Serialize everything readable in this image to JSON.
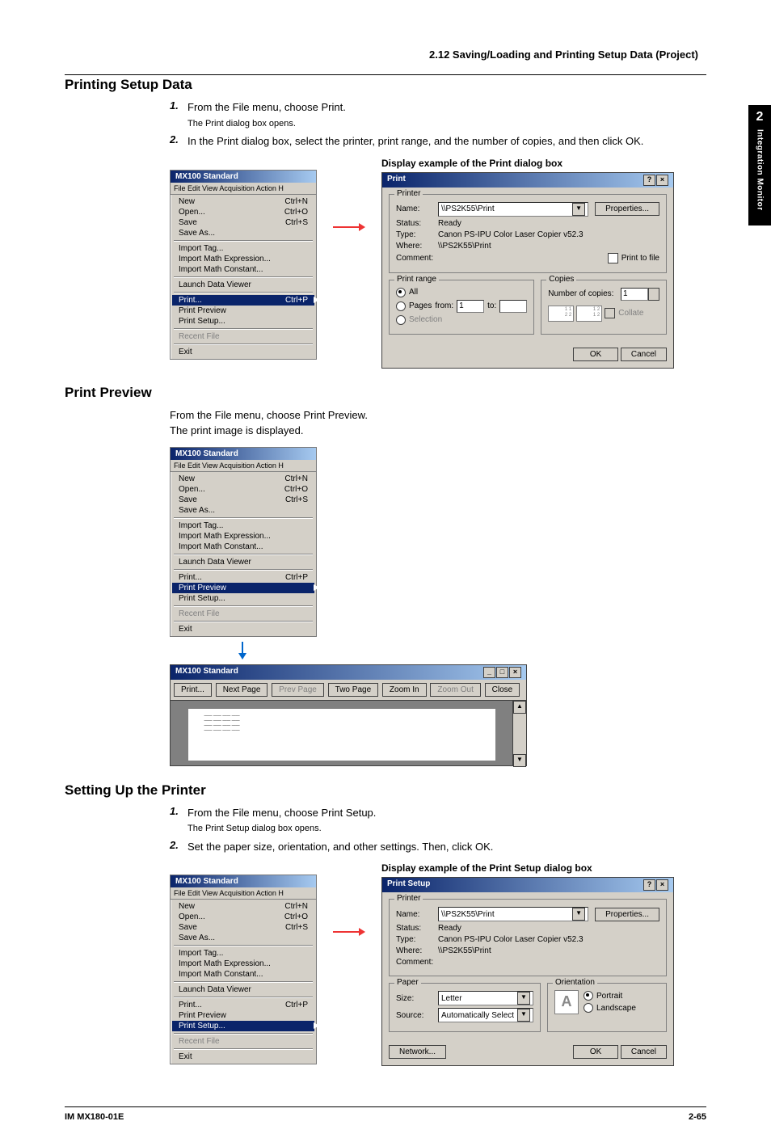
{
  "breadcrumb": "2.12  Saving/Loading and Printing Setup Data (Project)",
  "side_tab": {
    "num": "2",
    "label": "Integration Monitor"
  },
  "sec1": {
    "heading": "Printing Setup Data",
    "step1": {
      "num": "1.",
      "text": "From the File menu, choose Print.",
      "sub": "The Print dialog box opens."
    },
    "step2": {
      "num": "2.",
      "text": "In the Print dialog box, select the printer, print range, and the number of copies, and then click OK."
    },
    "caption": "Display example of the Print dialog box"
  },
  "sec2": {
    "heading": "Print Preview",
    "line1": "From the File menu, choose Print Preview.",
    "line2": "The print image is displayed."
  },
  "sec3": {
    "heading": "Setting Up the Printer",
    "step1": {
      "num": "1.",
      "text": "From the File menu, choose Print Setup.",
      "sub": "The Print Setup dialog box opens."
    },
    "step2": {
      "num": "2.",
      "text": "Set the paper size, orientation, and other settings. Then, click OK."
    },
    "caption": "Display example of the Print Setup dialog box"
  },
  "file_menu": {
    "title": "MX100 Standard",
    "menubar": "File   Edit   View   Acquisition   Action   H",
    "items": {
      "New": "New",
      "New_k": "Ctrl+N",
      "Open": "Open...",
      "Open_k": "Ctrl+O",
      "Save": "Save",
      "Save_k": "Ctrl+S",
      "SaveAs": "Save As...",
      "ImportTag": "Import Tag...",
      "ImportMathExpr": "Import Math Expression...",
      "ImportMathConst": "Import Math Constant...",
      "LaunchViewer": "Launch Data Viewer",
      "Print": "Print...",
      "Print_k": "Ctrl+P",
      "PrintPreview": "Print Preview",
      "PrintSetup": "Print Setup...",
      "RecentFile": "Recent File",
      "Exit": "Exit"
    }
  },
  "print_dialog": {
    "title": "Print",
    "printer_legend": "Printer",
    "name_lbl": "Name:",
    "name_val": "\\\\PS2K55\\Print",
    "properties_btn": "Properties...",
    "status_lbl": "Status:",
    "status_val": "Ready",
    "type_lbl": "Type:",
    "type_val": "Canon PS-IPU Color Laser Copier v52.3",
    "where_lbl": "Where:",
    "where_val": "\\\\PS2K55\\Print",
    "comment_lbl": "Comment:",
    "print_to_file": "Print to file",
    "range_legend": "Print range",
    "all": "All",
    "pages": "Pages",
    "from": "from:",
    "from_val": "1",
    "to": "to:",
    "selection": "Selection",
    "copies_legend": "Copies",
    "numcopies_lbl": "Number of copies:",
    "numcopies_val": "1",
    "collate": "Collate",
    "ok": "OK",
    "cancel": "Cancel"
  },
  "preview_win": {
    "title": "MX100 Standard",
    "toolbar": {
      "print": "Print...",
      "next": "Next Page",
      "prev": "Prev Page",
      "two": "Two Page",
      "zin": "Zoom In",
      "zout": "Zoom Out",
      "close": "Close"
    }
  },
  "setup_dialog": {
    "title": "Print Setup",
    "printer_legend": "Printer",
    "name_lbl": "Name:",
    "name_val": "\\\\PS2K55\\Print",
    "properties_btn": "Properties...",
    "status_lbl": "Status:",
    "status_val": "Ready",
    "type_lbl": "Type:",
    "type_val": "Canon PS-IPU Color Laser Copier v52.3",
    "where_lbl": "Where:",
    "where_val": "\\\\PS2K55\\Print",
    "comment_lbl": "Comment:",
    "paper_legend": "Paper",
    "size_lbl": "Size:",
    "size_val": "Letter",
    "source_lbl": "Source:",
    "source_val": "Automatically Select",
    "orient_legend": "Orientation",
    "portrait": "Portrait",
    "landscape": "Landscape",
    "network": "Network...",
    "ok": "OK",
    "cancel": "Cancel"
  },
  "footer": {
    "left": "IM MX180-01E",
    "right": "2-65"
  }
}
